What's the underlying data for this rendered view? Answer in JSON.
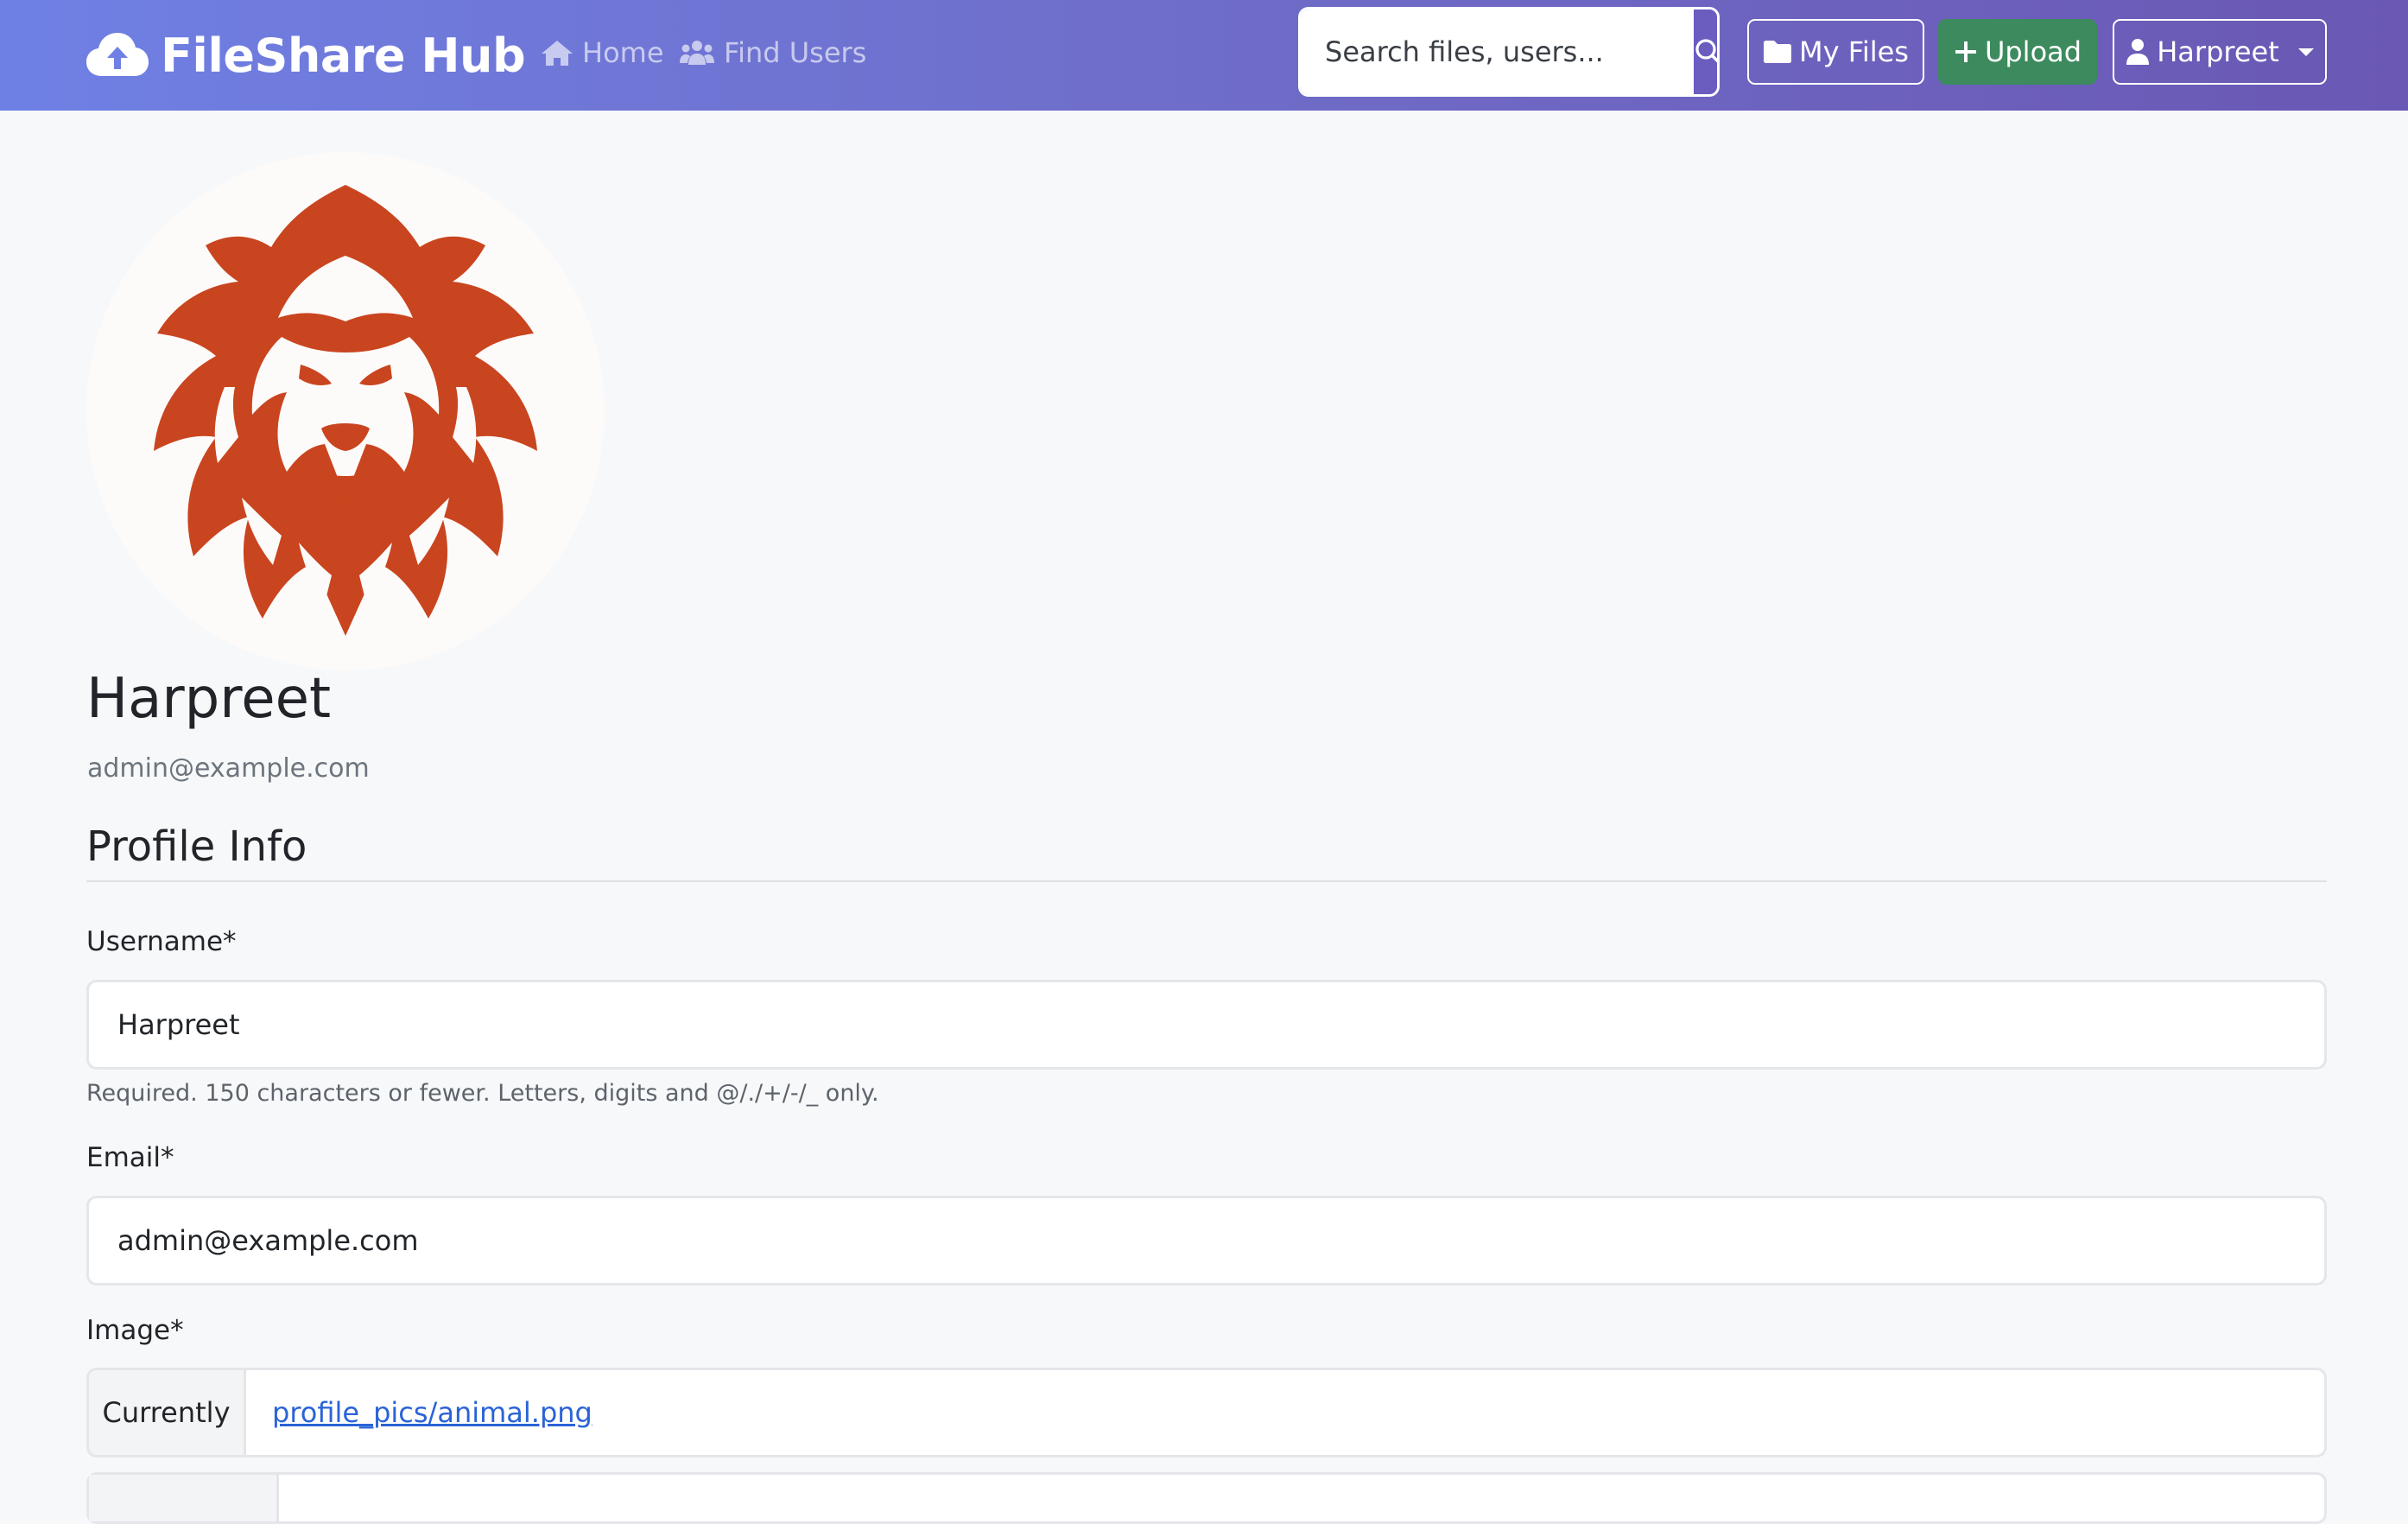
{
  "navbar": {
    "brand": "FileShare Hub",
    "home": "Home",
    "find_users": "Find Users",
    "search_placeholder": "Search files, users...",
    "my_files": "My Files",
    "upload": "Upload",
    "user_menu": "Harpreet"
  },
  "profile": {
    "name": "Harpreet",
    "email": "admin@example.com"
  },
  "form": {
    "section_title": "Profile Info",
    "username_label": "Username*",
    "username_value": "Harpreet",
    "username_help": "Required. 150 characters or fewer. Letters, digits and @/./+/-/_ only.",
    "email_label": "Email*",
    "email_value": "admin@example.com",
    "image_label": "Image*",
    "image_currently": "Currently",
    "image_link": "profile_pics/animal.png"
  },
  "icons": {
    "brand": "cloud-upload-icon",
    "home": "home-icon",
    "find_users": "users-icon",
    "search": "search-icon",
    "my_files": "folder-icon",
    "upload": "plus-icon",
    "user": "user-icon",
    "dropdown": "caret-down-icon"
  },
  "colors": {
    "navbar_start": "#6f80e4",
    "navbar_end": "#6a58b4",
    "upload_button": "#3d8a5e",
    "link": "#2a63d6",
    "lion": "#c9451f"
  }
}
